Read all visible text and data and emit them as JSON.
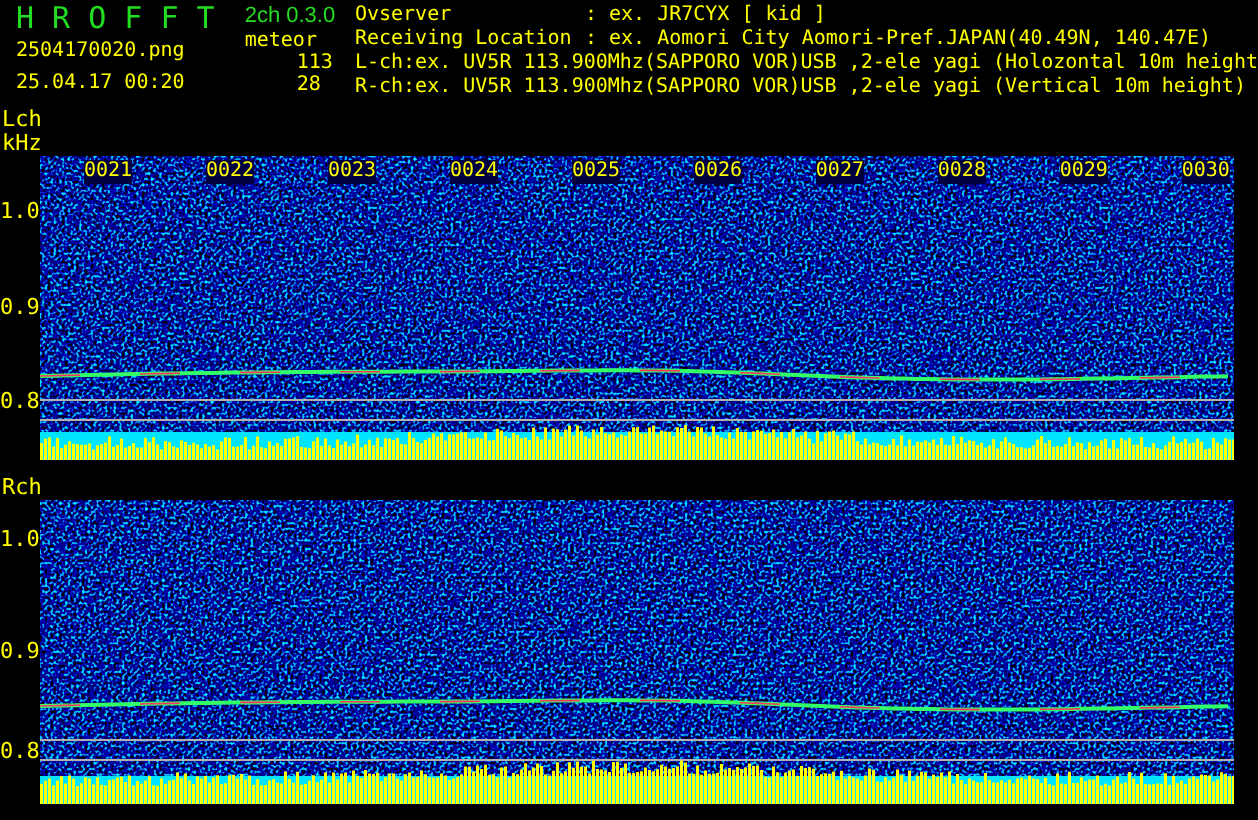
{
  "header": {
    "app_title": "H R O F F T",
    "version": "2ch 0.3.0",
    "filename": "2504170020.png",
    "datetime": "25.04.17 00:20",
    "meteor_label": "meteor",
    "meteor_counts": [
      "113",
      "28"
    ],
    "info": [
      {
        "label": "Ovserver",
        "value": ": ex. JR7CYX [ kid ]"
      },
      {
        "label": "Receiving Location",
        "value": ": ex. Aomori City Aomori-Pref.JAPAN(40.49N, 140.47E)"
      }
    ],
    "channels": [
      "L-ch:ex. UV5R 113.900Mhz(SAPPORO VOR)USB ,2-ele yagi (Holozontal 10m height",
      "R-ch:ex. UV5R 113.900Mhz(SAPPORO VOR)USB ,2-ele yagi (Vertical 10m height)"
    ]
  },
  "panels": [
    {
      "label": "Lch",
      "unit": "kHz",
      "time_labels": [
        "0021",
        "0022",
        "0023",
        "0024",
        "0025",
        "0026",
        "0027",
        "0028",
        "0029",
        "0030"
      ],
      "y_ticks": [
        "1.0",
        "0.9",
        "0.8"
      ]
    },
    {
      "label": "Rch",
      "y_ticks": [
        "1.0",
        "0.9",
        "0.8"
      ]
    }
  ]
}
